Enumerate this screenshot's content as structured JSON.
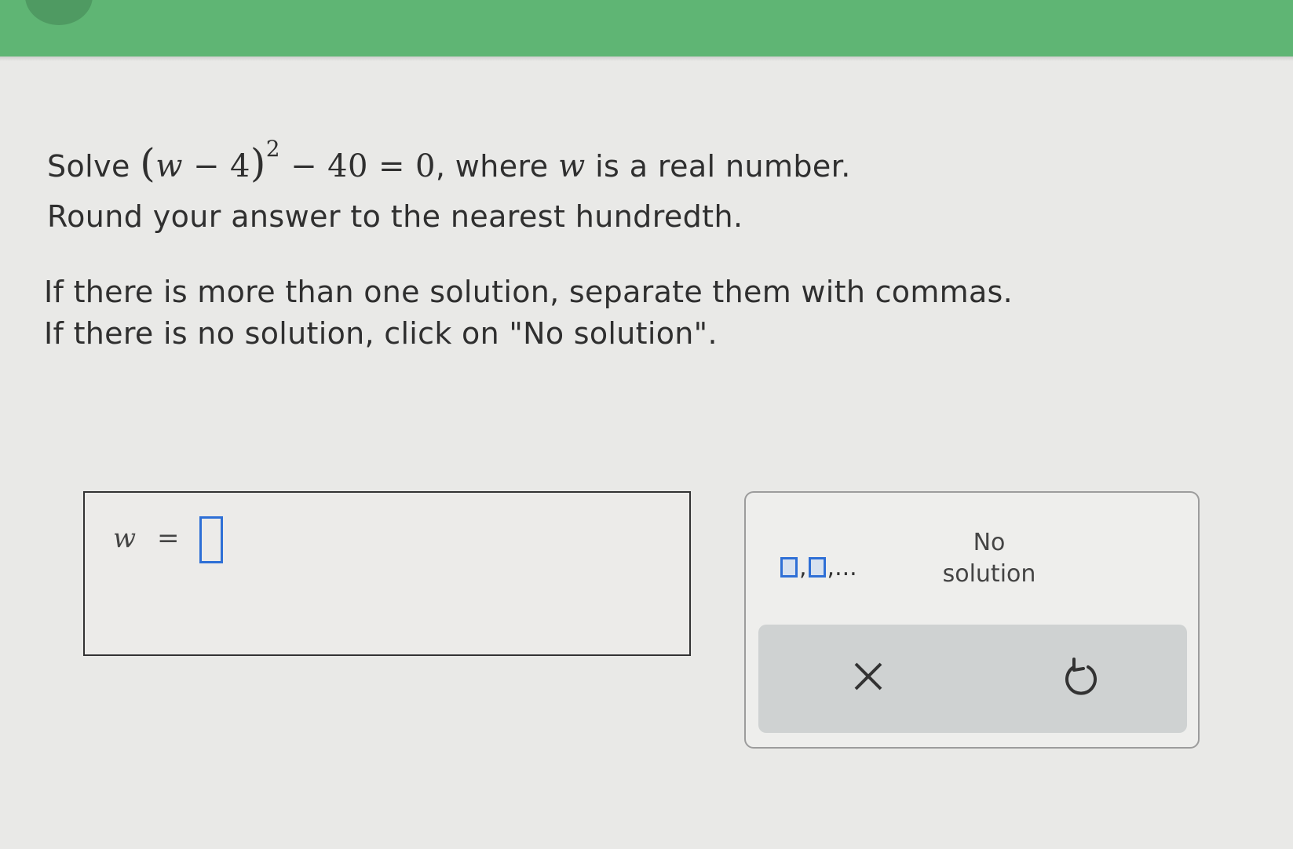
{
  "problem": {
    "solve_label": "Solve",
    "eq_lparen": "(",
    "eq_var": "w",
    "eq_minus1": " − 4",
    "eq_rparen": ")",
    "eq_exp": "2",
    "eq_rest": " − 40 = 0",
    "where_prefix": ", where ",
    "where_var": "w",
    "where_suffix": " is a real number.",
    "round_text": "Round your answer to the nearest hundredth."
  },
  "instructions": {
    "line1": "If there is more than one solution, separate them with commas.",
    "line2": "If there is no solution, click on \"No solution\"."
  },
  "answer": {
    "variable": "w",
    "equals": "=",
    "value": ""
  },
  "keypad": {
    "multi_text": ",",
    "multi_ellipsis": ",...",
    "no_solution_line1": "No",
    "no_solution_line2": "solution",
    "clear_symbol": "×"
  },
  "colors": {
    "top_bar": "#5fb574",
    "input_border": "#2e6fd6"
  },
  "icons": [
    "clear-icon",
    "undo-icon",
    "multi-answer-icon"
  ]
}
